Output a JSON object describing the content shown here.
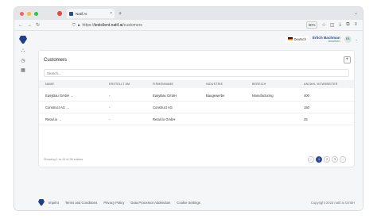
{
  "browser": {
    "tab_title": "Natif AI",
    "tab_close": "×",
    "new_tab": "+",
    "url_prefix": "https://",
    "url_host": "testclient.natif.ai",
    "url_path": "/customers",
    "zoom": "80%",
    "colors": {
      "close": "#ff5f57",
      "minimize": "#febc2e",
      "maximize": "#28c840",
      "tab_favicon": "#e8453c"
    }
  },
  "header": {
    "language": "Deutsch",
    "user_name": "Erlich Bachman",
    "user_role": "Ansehen",
    "avatar_initials": "EB"
  },
  "customers": {
    "title": "Customers",
    "add_label": "+",
    "search_placeholder": "Search...",
    "columns": [
      "NAME",
      "ERSTELLT AM",
      "FIRMENNAME",
      "INDUSTRIE",
      "BEREICH",
      "ANZAHL MITARBEITER"
    ],
    "rows": [
      {
        "name": "EasyBau GmbH",
        "created": "-",
        "company": "EasyBau GmbH",
        "industry": "Baugewerbe",
        "area": "Manufacturing",
        "employees": "400"
      },
      {
        "name": "Construct AG",
        "created": "-",
        "company": "Construct AG",
        "industry": "",
        "area": "",
        "employees": "150"
      },
      {
        "name": "Retail.io",
        "created": "-",
        "company": "Retail.io GmbH",
        "industry": "",
        "area": "",
        "employees": "25"
      }
    ],
    "showing": "Showing 1 to 10 of 36 entries",
    "pages": [
      "‹",
      "1",
      "2",
      "3",
      "›"
    ],
    "active_page": "1"
  },
  "footer": {
    "links": [
      "Imprint",
      "Terms and Conditions",
      "Privacy Policy",
      "Data Processor Addendum",
      "Cookie Settings"
    ],
    "copyright": "Copyright 2023 natif.ai GmbH"
  },
  "icons": [
    "back-icon",
    "forward-icon",
    "reload-icon",
    "shield-icon",
    "lock-icon",
    "star-icon",
    "pocket-icon",
    "download-icon",
    "extensions-icon",
    "menu-icon",
    "dashboard-icon",
    "history-icon",
    "calendar-icon",
    "chevron-down-icon"
  ]
}
